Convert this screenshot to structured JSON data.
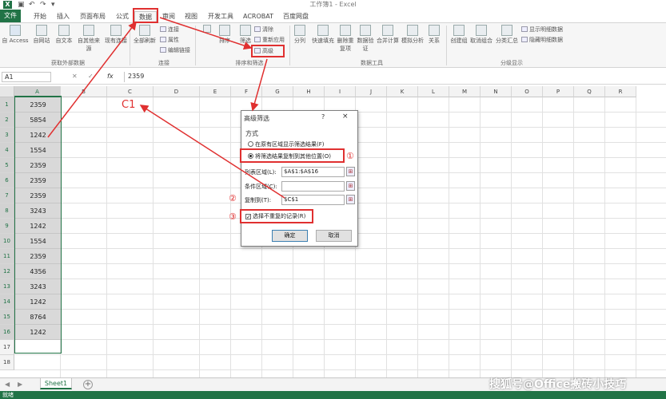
{
  "titlebar": {
    "logo": "X",
    "title": "工作簿1 - Excel"
  },
  "tabs": [
    {
      "label": "文件"
    },
    {
      "label": "开始"
    },
    {
      "label": "插入"
    },
    {
      "label": "页面布局"
    },
    {
      "label": "公式"
    },
    {
      "label": "数据"
    },
    {
      "label": "审阅"
    },
    {
      "label": "视图"
    },
    {
      "label": "开发工具"
    },
    {
      "label": "ACROBAT"
    },
    {
      "label": "百度网盘"
    }
  ],
  "ribbon": {
    "get_external": {
      "access": "自 Access",
      "web": "自网站",
      "text": "自文本",
      "other": "自其他来源",
      "existing": "现有连接",
      "group": "获取外部数据"
    },
    "connections": {
      "refresh_all": "全部刷新",
      "connections": "连接",
      "properties": "属性",
      "edit_links": "编辑链接",
      "group": "连接"
    },
    "sort_filter": {
      "sort": "排序",
      "filter": "筛选",
      "clear": "清除",
      "reapply": "重新应用",
      "advanced": "高级",
      "group": "排序和筛选"
    },
    "data_tools": {
      "split": "分列",
      "flash_fill": "快速填充",
      "remove_dup": "删除重复项",
      "validation": "数据验证",
      "consolidate": "合并计算",
      "what_if": "模拟分析",
      "relations": "关系",
      "group": "数据工具"
    },
    "outline": {
      "group_btn": "创建组",
      "ungroup": "取消组合",
      "subtotal": "分类汇总",
      "show_detail": "显示明细数据",
      "hide_detail": "隐藏明细数据",
      "group": "分级显示"
    }
  },
  "formulabar": {
    "name_box": "A1",
    "fx": "fx",
    "value": "2359"
  },
  "grid": {
    "columns": [
      "A",
      "B",
      "C",
      "D",
      "E",
      "F",
      "G",
      "H",
      "I",
      "J",
      "K",
      "L",
      "M",
      "N",
      "O",
      "P",
      "Q",
      "R"
    ],
    "rows": [
      "1",
      "2",
      "3",
      "4",
      "5",
      "6",
      "7",
      "8",
      "9",
      "10",
      "11",
      "12",
      "13",
      "14",
      "15",
      "16",
      "17",
      "18"
    ],
    "column_a_values": [
      "2359",
      "5854",
      "1242",
      "1554",
      "2359",
      "2359",
      "2359",
      "3243",
      "1242",
      "1554",
      "2359",
      "4356",
      "3243",
      "1242",
      "8764",
      "1242"
    ]
  },
  "sheetbar": {
    "sheet": "Sheet1",
    "add": "+",
    "status": "就绪"
  },
  "dialog": {
    "title": "高级筛选",
    "help": "?",
    "close": "×",
    "section": "方式",
    "option1": "在原有区域显示筛选结果(F)",
    "option2": "将筛选结果复制到其他位置(O)",
    "list_range_label": "列表区域(L):",
    "list_range_value": "$A$1:$A$16",
    "criteria_label": "条件区域(C):",
    "criteria_value": "",
    "copy_to_label": "复制到(T):",
    "copy_to_value": "$C$1",
    "unique_label": "选择不重复的记录(R)",
    "ok": "确定",
    "cancel": "取消"
  },
  "annotations": {
    "c1": "C1",
    "n1": "①",
    "n2": "②",
    "n3": "③",
    "accent": "#e03030"
  },
  "watermark": "搜狐号@Office搬砖小技巧",
  "colors": {
    "excel_green": "#217346"
  }
}
